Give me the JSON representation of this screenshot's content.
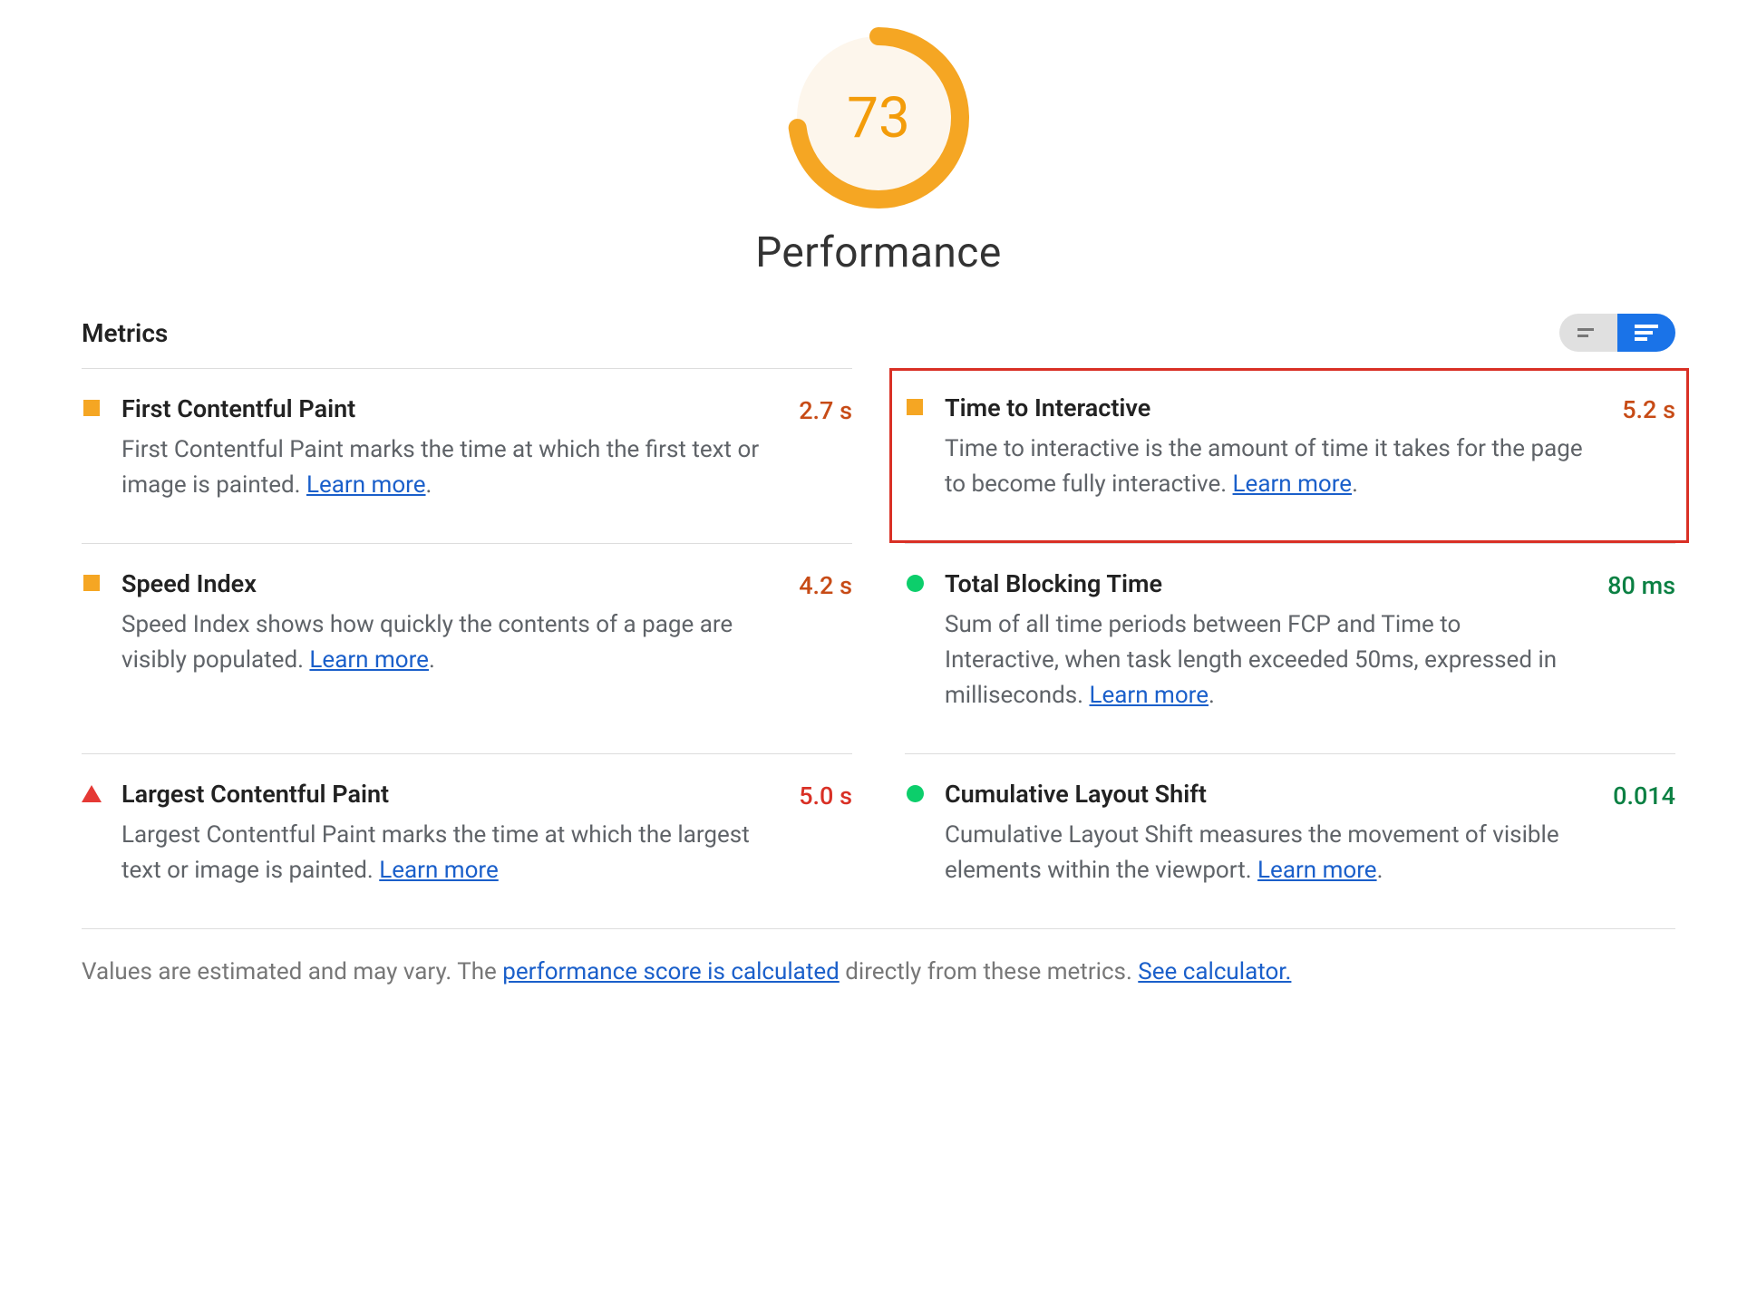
{
  "gauge": {
    "score": "73",
    "title": "Performance"
  },
  "section_title": "Metrics",
  "metrics": {
    "fcp": {
      "name": "First Contentful Paint",
      "desc": "First Contentful Paint marks the time at which the first text or image is painted. ",
      "learn": "Learn more",
      "value": "2.7 s"
    },
    "tti": {
      "name": "Time to Interactive",
      "desc": "Time to interactive is the amount of time it takes for the page to become fully interactive. ",
      "learn": "Learn more",
      "value": "5.2 s"
    },
    "si": {
      "name": "Speed Index",
      "desc": "Speed Index shows how quickly the contents of a page are visibly populated. ",
      "learn": "Learn more",
      "value": "4.2 s"
    },
    "tbt": {
      "name": "Total Blocking Time",
      "desc": "Sum of all time periods between FCP and Time to Interactive, when task length exceeded 50ms, expressed in milliseconds. ",
      "learn": "Learn more",
      "value": "80 ms"
    },
    "lcp": {
      "name": "Largest Contentful Paint",
      "desc": "Largest Contentful Paint marks the time at which the largest text or image is painted. ",
      "learn": "Learn more",
      "value": "5.0 s"
    },
    "cls": {
      "name": "Cumulative Layout Shift",
      "desc": "Cumulative Layout Shift measures the movement of visible elements within the viewport. ",
      "learn": "Learn more",
      "value": "0.014"
    }
  },
  "footnote": {
    "pre": "Values are estimated and may vary. The ",
    "link1": "performance score is calculated",
    "mid": " directly from these metrics. ",
    "link2": "See calculator."
  }
}
